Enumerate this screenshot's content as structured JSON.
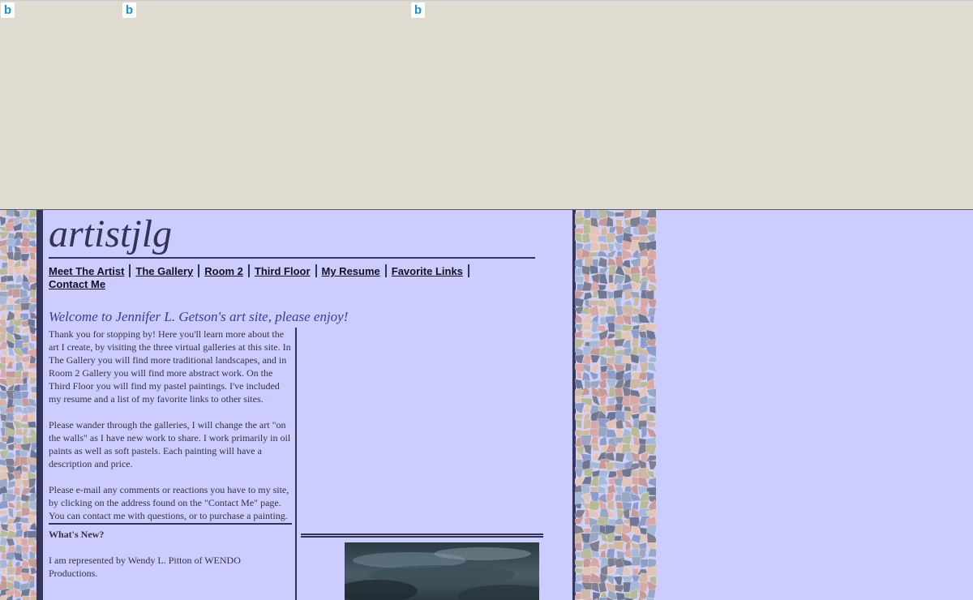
{
  "ad_band": {
    "icon_letter": "b",
    "color": "#dfdbd0"
  },
  "site": {
    "logo": "artistjlg",
    "nav": [
      {
        "label": "Meet The Artist"
      },
      {
        "label": "The Gallery"
      },
      {
        "label": "Room 2"
      },
      {
        "label": "Third Floor"
      },
      {
        "label": "My Resume"
      },
      {
        "label": "Favorite Links"
      },
      {
        "label": "Contact Me"
      }
    ],
    "welcome": "Welcome to Jennifer L. Getson's art site, please enjoy!"
  },
  "main": {
    "paragraphs": [
      "Thank you for stopping by! Here you'll learn more about the art I create, by visiting the three virtual galleries at this site. In The Gallery you will find more traditional landscapes, and in Room 2 Gallery you will find more abstract work. On the Third Floor you will find my pastel paintings. I've included my resume and a list of my favorite links to other sites.",
      "Please wander through the galleries, I will change the art \"on the walls\" as I have new work to share. I work primarily in oil paints as well as soft pastels. Each painting will have a description and price.",
      "Please e-mail any comments or reactions you have to my site, by clicking on the address found on the \"Contact Me\" page. You can contact me with questions, or to purchase a painting."
    ],
    "whats_new_title": "What's New?",
    "whats_new_text": "I am represented by Wendy L. Pitton of WENDO Productions."
  },
  "colors": {
    "page_bg": "#ccccff",
    "accent": "#333355",
    "welcome": "#3b3b96"
  }
}
